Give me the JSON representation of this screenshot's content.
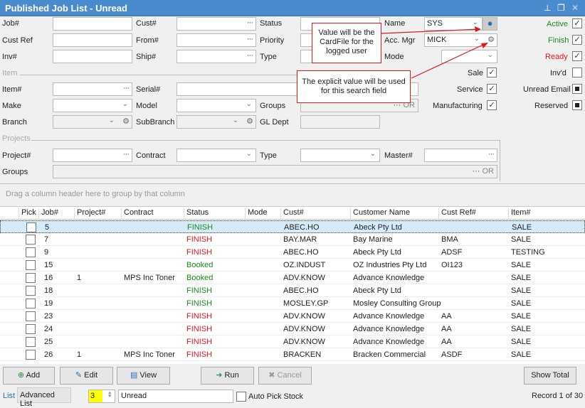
{
  "window": {
    "title": "Published Job List - Unread",
    "pin": "⊥",
    "restore": "❐",
    "close": "✕"
  },
  "filters": {
    "job": "Job#",
    "cust": "Cust#",
    "status": "Status",
    "name": "Name",
    "name_value": "SYS",
    "cust_ref": "Cust Ref",
    "from": "From#",
    "priority": "Priority",
    "acc_mgr": "Acc. Mgr",
    "acc_mgr_value": "MICK",
    "inv": "Inv#",
    "ship": "Ship#",
    "type": "Type",
    "mode": "Mode",
    "item_section": "Item",
    "item": "Item#",
    "serial": "Serial#",
    "make": "Make",
    "model": "Model",
    "groups": "Groups",
    "branch": "Branch",
    "subbranch": "SubBranch",
    "gl_dept": "GL Dept",
    "projects_section": "Projects",
    "project": "Project#",
    "contract": "Contract",
    "proj_type": "Type",
    "master": "Master#",
    "proj_groups": "Groups",
    "or": "OR"
  },
  "checks": {
    "active": {
      "label": "Active",
      "checked": true
    },
    "finish": {
      "label": "Finish",
      "checked": true
    },
    "ready": {
      "label": "Ready",
      "checked": true
    },
    "invd": {
      "label": "Inv'd",
      "checked": false
    },
    "unread_email": {
      "label": "Unread Email",
      "state": "indeterminate"
    },
    "reserved": {
      "label": "Reserved",
      "state": "indeterminate"
    },
    "sale": {
      "label": "Sale",
      "checked": true
    },
    "service": {
      "label": "Service",
      "checked": true
    },
    "manufacturing": {
      "label": "Manufacturing",
      "checked": true
    }
  },
  "callouts": {
    "c1": "Value will be the CardFile for the logged user",
    "c2": "The explicit value will be used for this search field"
  },
  "group_hint": "Drag a column header here to group by that column",
  "columns": [
    "Pick",
    "Job#",
    "Project#",
    "Contract",
    "Status",
    "Mode",
    "Cust#",
    "Customer Name",
    "Cust Ref#",
    "Item#"
  ],
  "rows": [
    [
      "",
      "5",
      "",
      "",
      "FINISH",
      "",
      "ABEC.HO",
      "Abeck Pty Ltd",
      "",
      "SALE"
    ],
    [
      "",
      "7",
      "",
      "",
      "FINISH",
      "",
      "BAY.MAR",
      "Bay Marine",
      "BMA",
      "SALE"
    ],
    [
      "",
      "9",
      "",
      "",
      "FINISH",
      "",
      "ABEC.HO",
      "Abeck Pty Ltd",
      "ADSF",
      "TESTING"
    ],
    [
      "",
      "15",
      "",
      "",
      "Booked",
      "",
      "OZ.INDUST",
      "OZ Industries Pty Ltd",
      "OI123",
      "SALE"
    ],
    [
      "",
      "16",
      "1",
      "MPS Inc Toner",
      "Booked",
      "",
      "ADV.KNOW",
      "Advance Knowledge",
      "",
      "SALE"
    ],
    [
      "",
      "18",
      "",
      "",
      "FINISH",
      "",
      "ABEC.HO",
      "Abeck Pty Ltd",
      "",
      "SALE"
    ],
    [
      "",
      "19",
      "",
      "",
      "FINISH",
      "",
      "MOSLEY.GP",
      "Mosley Consulting Group",
      "",
      "SALE"
    ],
    [
      "",
      "23",
      "",
      "",
      "FINISH",
      "",
      "ADV.KNOW",
      "Advance Knowledge",
      "AA",
      "SALE"
    ],
    [
      "",
      "24",
      "",
      "",
      "FINISH",
      "",
      "ADV.KNOW",
      "Advance Knowledge",
      "AA",
      "SALE"
    ],
    [
      "",
      "25",
      "",
      "",
      "FINISH",
      "",
      "ADV.KNOW",
      "Advance Knowledge",
      "AA",
      "SALE"
    ],
    [
      "",
      "26",
      "1",
      "MPS Inc Toner",
      "FINISH",
      "",
      "BRACKEN",
      "Bracken Commercial",
      "ASDF",
      "SALE"
    ]
  ],
  "status_colors": {
    "FINISH": "#e8141e",
    "Booked": "#1a8a1a",
    "FINISH_green": "#1a8a1a"
  },
  "toolbar": {
    "add": "Add",
    "edit": "Edit",
    "view": "View",
    "run": "Run",
    "cancel": "Cancel",
    "show_total": "Show Total"
  },
  "footer": {
    "list_tab": "List",
    "advanced_tab": "Advanced List",
    "count": "3",
    "view_name": "Unread",
    "auto_pick": "Auto Pick Stock",
    "record": "Record 1 of 30"
  }
}
